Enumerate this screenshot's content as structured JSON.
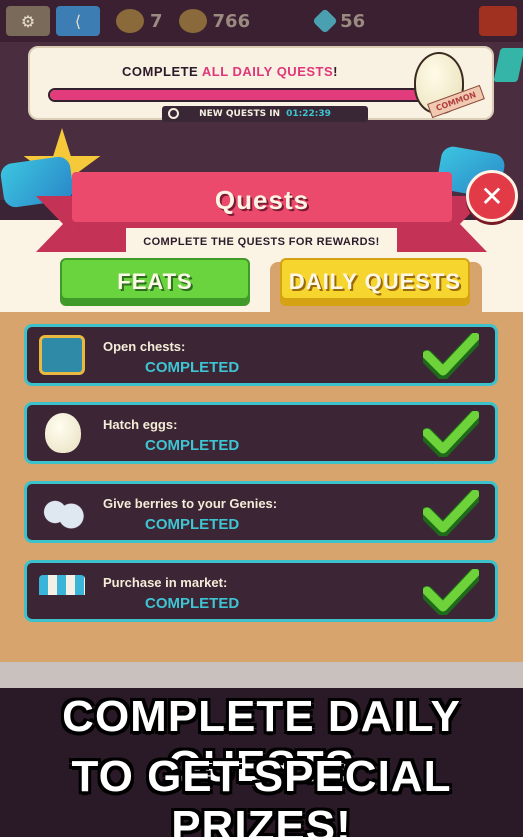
{
  "hud": {
    "settings_icon": "gear-icon",
    "share_icon": "share-icon",
    "coins_value": "7",
    "gold_value": "766",
    "gems_value": "56"
  },
  "daily_progress": {
    "title_prefix": "Complete ",
    "title_highlight": "all daily quests",
    "title_suffix": "!",
    "progress_fraction": 1.0,
    "new_quests_label": "New quests in",
    "new_quests_time": "01:22:39",
    "reward_tag": "COMMON"
  },
  "quests_panel": {
    "title": "Quests",
    "subtitle": "Complete the Quests for rewards!",
    "close_label": "✕",
    "tabs": [
      {
        "label": "Feats"
      },
      {
        "label": "Daily Quests"
      }
    ],
    "items": [
      {
        "label": "Open chests:",
        "status": "Completed",
        "icon": "chest-icon"
      },
      {
        "label": "Hatch eggs:",
        "status": "Completed",
        "icon": "egg-icon"
      },
      {
        "label": "Give berries to your Genies:",
        "status": "Completed",
        "icon": "berries-icon"
      },
      {
        "label": "Purchase in market:",
        "status": "Completed",
        "icon": "market-stall-icon"
      }
    ]
  },
  "promo": {
    "line1": "COMPLETE DAILY QUESTS",
    "line2": "TO GET SPECIAL PRIZES!"
  },
  "colors": {
    "accent_pink": "#e23c7c",
    "accent_teal": "#3ec4d2",
    "feats_green": "#69d43e",
    "daily_yellow": "#f7d52f"
  }
}
